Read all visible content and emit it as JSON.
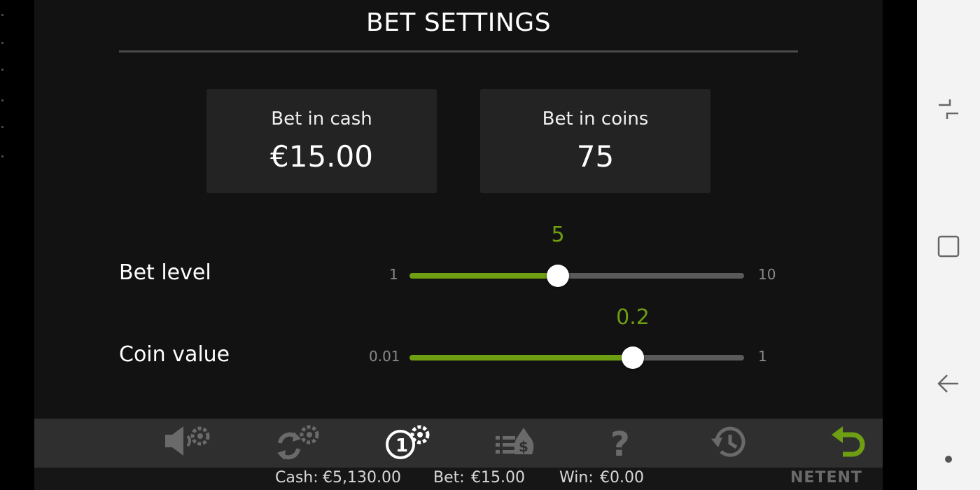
{
  "title": "BET SETTINGS",
  "bet_in_cash": {
    "label": "Bet in cash",
    "value": "€15.00"
  },
  "bet_in_coins": {
    "label": "Bet in coins",
    "value": "75"
  },
  "bet_level": {
    "label": "Bet level",
    "min": "1",
    "max": "10",
    "value": "5",
    "fill_fraction": 0.444
  },
  "coin_value": {
    "label": "Coin value",
    "min": "0.01",
    "max": "1",
    "value": "0.2",
    "fill_fraction": 0.667
  },
  "toolbar": {
    "icons": [
      "sound-settings-icon",
      "autoplay-settings-icon",
      "bet-settings-icon",
      "paytable-icon",
      "help-icon",
      "history-icon",
      "back-icon"
    ]
  },
  "status": {
    "cash_label": "Cash:",
    "cash_value": "€5,130.00",
    "bet_label": "Bet:",
    "bet_value": "€15.00",
    "win_label": "Win:",
    "win_value": "€0.00",
    "brand": "NETENT"
  },
  "colors": {
    "accent": "#6e9e12",
    "background": "#121212",
    "card": "#232323",
    "toolbar": "#2f2f2f"
  }
}
